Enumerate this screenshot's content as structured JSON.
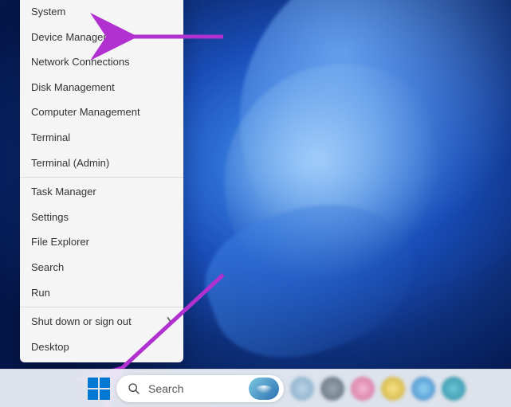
{
  "context_menu": {
    "items": [
      {
        "label": "System"
      },
      {
        "label": "Device Manager"
      },
      {
        "label": "Network Connections"
      },
      {
        "label": "Disk Management"
      },
      {
        "label": "Computer Management"
      },
      {
        "label": "Terminal"
      },
      {
        "label": "Terminal (Admin)"
      }
    ],
    "items2": [
      {
        "label": "Task Manager"
      },
      {
        "label": "Settings"
      },
      {
        "label": "File Explorer"
      },
      {
        "label": "Search"
      },
      {
        "label": "Run"
      }
    ],
    "items3": [
      {
        "label": "Shut down or sign out",
        "submenu": true
      },
      {
        "label": "Desktop"
      }
    ]
  },
  "taskbar": {
    "search_placeholder": "Search"
  },
  "annotations": {
    "arrow_color": "#b030d0"
  }
}
